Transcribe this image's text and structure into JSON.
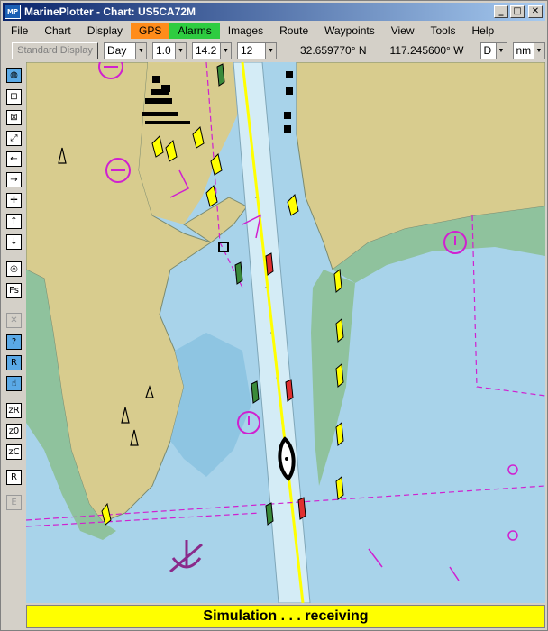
{
  "window": {
    "icon_text": "MP",
    "title": "MarinePlotter - Chart: US5CA72M",
    "min_glyph": "_",
    "max_glyph": "□",
    "close_glyph": "✕"
  },
  "menu": {
    "items": [
      "File",
      "Chart",
      "Display",
      "GPS",
      "Alarms",
      "Images",
      "Route",
      "Waypoints",
      "View",
      "Tools",
      "Help"
    ],
    "highlight_colors": {
      "GPS": "#ff8c1a",
      "Alarms": "#2ecc40"
    }
  },
  "toolbar": {
    "standard_display_label": "Standard Display",
    "mode_value": "Day",
    "scale_value": "1.0",
    "zoom_value": "14.2",
    "size_value": "12",
    "latitude": "32.659770° N",
    "longitude": "117.245600° W",
    "heading_value": "D",
    "units_value": "nm"
  },
  "tools": [
    {
      "name": "globe-icon",
      "glyph": "◍",
      "style": "blue"
    },
    {
      "name": "zoom-in-icon",
      "glyph": "⊡",
      "style": ""
    },
    {
      "name": "zoom-out-icon",
      "glyph": "⊠",
      "style": ""
    },
    {
      "name": "fit-icon",
      "glyph": "⤢",
      "style": ""
    },
    {
      "name": "pan-left-icon",
      "glyph": "←",
      "style": ""
    },
    {
      "name": "pan-right-icon",
      "glyph": "→",
      "style": ""
    },
    {
      "name": "center-icon",
      "glyph": "✛",
      "style": ""
    },
    {
      "name": "pan-up-icon",
      "glyph": "↑",
      "style": ""
    },
    {
      "name": "pan-down-icon",
      "glyph": "↓",
      "style": ""
    },
    {
      "name": "target-icon",
      "glyph": "◎",
      "style": ""
    },
    {
      "name": "fs-icon",
      "glyph": "Fs",
      "style": ""
    },
    {
      "name": "cancel-icon",
      "glyph": "✕",
      "style": "disabled"
    },
    {
      "name": "help-icon",
      "glyph": "?",
      "style": "blue"
    },
    {
      "name": "route-icon",
      "glyph": "R",
      "style": "blue"
    },
    {
      "name": "hand-icon",
      "glyph": "☝",
      "style": "blue"
    },
    {
      "name": "zoom-range-icon",
      "glyph": "zR",
      "style": ""
    },
    {
      "name": "zoom-zero-icon",
      "glyph": "z0",
      "style": ""
    },
    {
      "name": "zoom-chart-icon",
      "glyph": "zC",
      "style": ""
    },
    {
      "name": "r-icon",
      "glyph": "R",
      "style": ""
    },
    {
      "name": "e-icon",
      "glyph": "E",
      "style": "disabled"
    }
  ],
  "status": {
    "text": "Simulation . . . receiving"
  },
  "chart": {
    "colors": {
      "water": "#a8d3ea",
      "shallow": "#8ec5e2",
      "land": "#d8cc8e",
      "green_area": "#8fc29d",
      "channel_line": "#ffff00",
      "magenta": "#d020d0",
      "buoy_yellow": "#ffff00",
      "buoy_red": "#e03030"
    }
  }
}
